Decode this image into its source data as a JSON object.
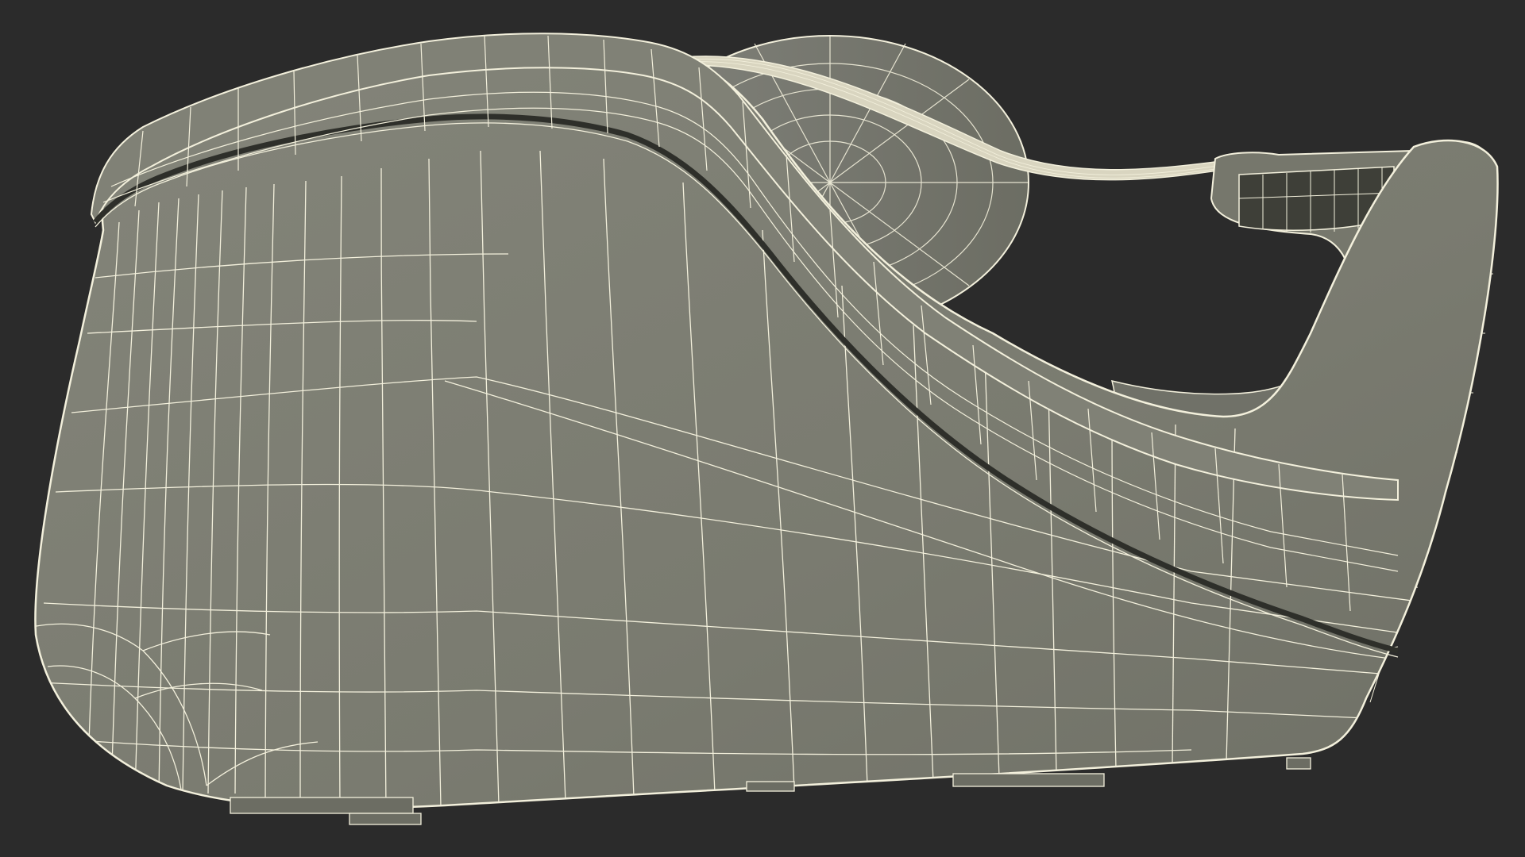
{
  "scene": {
    "background_color": "#2b2b2b",
    "mesh_fill_color": "#7b7c71",
    "mesh_fill_light": "#85867a",
    "mesh_fill_dark": "#5f6055",
    "wire_color": "#f3f0dc",
    "tape_color": "#eeead6",
    "subject": "tape-dispenser-wireframe"
  }
}
